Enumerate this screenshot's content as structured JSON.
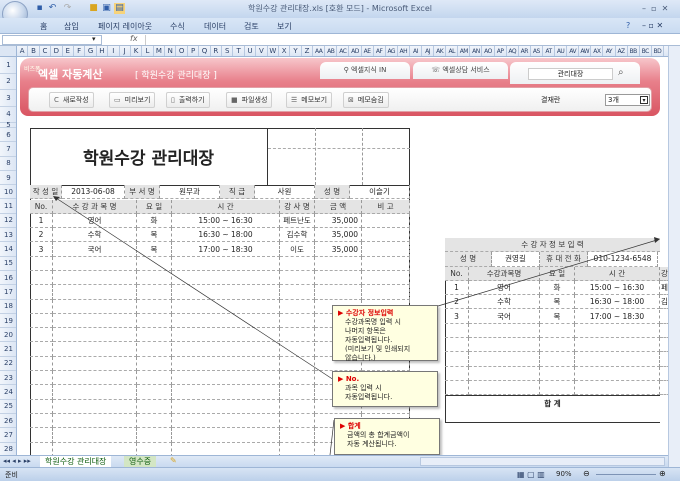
{
  "window": {
    "title": "학원수강 관리대장.xls  [호환 모드] - Microsoft Excel"
  },
  "ribbon": {
    "tabs": [
      "홈",
      "삽입",
      "페이지 레이아웃",
      "수식",
      "데이터",
      "검토",
      "보기"
    ]
  },
  "formula_bar": {
    "fx": "fx",
    "name_box": "",
    "value": ""
  },
  "columns": [
    "A",
    "B",
    "C",
    "D",
    "E",
    "F",
    "G",
    "H",
    "I",
    "J",
    "K",
    "L",
    "M",
    "N",
    "O",
    "P",
    "Q",
    "R",
    "S",
    "T",
    "U",
    "V",
    "W",
    "X",
    "Y",
    "Z",
    "AA",
    "AB",
    "AC",
    "AD",
    "AE",
    "AF",
    "AG",
    "AH",
    "AI",
    "AJ",
    "AK",
    "AL",
    "AM",
    "AN",
    "AO",
    "AP",
    "AQ",
    "AR",
    "AS",
    "AT",
    "AU",
    "AV",
    "AW",
    "AX",
    "AY",
    "AZ",
    "BB",
    "BC",
    "BD"
  ],
  "banner": {
    "brand_small": "비즈폼",
    "brand": "엑셀 자동계산",
    "subtitle": "[ 학원수강 관리대장 ]",
    "tabs": [
      "엑셀지식 IN",
      "엑셀상담 서비스"
    ],
    "search_value": "관리대장",
    "buttons": [
      "새로작성",
      "미리보기",
      "출력하기",
      "파일생성",
      "메모보기",
      "메모숨김"
    ],
    "approval_label": "결재란",
    "approval_value": "3개"
  },
  "ledger": {
    "title": "학원수강 관리대장",
    "info": {
      "date_label": "작 성 일",
      "date": "2013-06-08",
      "dept_label": "부 서 명",
      "dept": "원무과",
      "rank_label": "직  급",
      "rank": "사원",
      "name_label": "성  명",
      "name": "이슬기"
    },
    "headers": [
      "No.",
      "수 강 과 목 명",
      "요  일",
      "시          간",
      "강 사 명",
      "금    액",
      "비    고"
    ],
    "rows": [
      [
        "1",
        "영어",
        "화",
        "15:00 ~ 16:30",
        "페트난도",
        "35,000",
        ""
      ],
      [
        "2",
        "수학",
        "목",
        "16:30 ~ 18:00",
        "김수학",
        "35,000",
        ""
      ],
      [
        "3",
        "국어",
        "목",
        "17:00 ~ 18:30",
        "이도",
        "35,000",
        ""
      ]
    ]
  },
  "student_form": {
    "title": "수   강   자     정   보   입   력",
    "name_label": "성    명",
    "name": "권영길",
    "phone_label": "휴 대 전 화",
    "phone": "010-1234-6548",
    "headers": [
      "No.",
      "수강과목명",
      "요  일",
      "시          간",
      "강"
    ],
    "rows": [
      [
        "1",
        "영어",
        "화",
        "15:00 ~ 16:30",
        "페"
      ],
      [
        "2",
        "수학",
        "목",
        "16:30 ~ 18:00",
        "김"
      ],
      [
        "3",
        "국어",
        "목",
        "17:00 ~ 18:30",
        ""
      ]
    ],
    "total_label": "합                    계"
  },
  "comments": [
    {
      "title": "▶ 수강자 정보입력",
      "lines": [
        "수강과목명 입력 시",
        "나머지 항목은",
        "자동입력됩니다.",
        "(미리보기 및 인쇄되지",
        "않습니다.)"
      ]
    },
    {
      "title": "▶ No.",
      "lines": [
        "과목 입력 시",
        "자동입력됩니다."
      ]
    },
    {
      "title": "▶ 합계",
      "lines": [
        "금액의 총 합계금액이",
        "자동 계산됩니다."
      ]
    }
  ],
  "sheet_tabs": [
    "학원수강 관리대장",
    "영수증"
  ],
  "status": {
    "ready": "준비",
    "zoom": "90%"
  }
}
